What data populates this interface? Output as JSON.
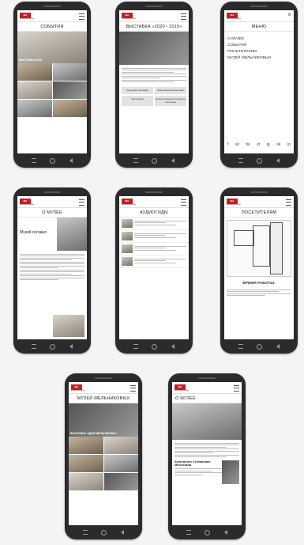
{
  "logo": {
    "text": "МА"
  },
  "phones": {
    "events": {
      "title": "СОБЫТИЯ",
      "hero_caption": "ВЫСТАВКА 2020"
    },
    "exhibition": {
      "title": "ВЫСТАВКА «2020 - 2015»",
      "buttons": [
        "Культурное наследие",
        "Какие вещества выставки",
        "Экспозиция",
        "Дополнительные материалы к выставке"
      ]
    },
    "menu": {
      "title": "МЕНЮ",
      "items": [
        "О МУЗЕЕ",
        "СОБЫТИЯ",
        "ПОСЕТИТЕЛЯМ",
        "МУЗЕЙ МЕЛЬНИКОВЫХ"
      ],
      "social_icons": [
        "f",
        "vk",
        "tw",
        "yt",
        "ig",
        "ok",
        "in"
      ]
    },
    "about": {
      "title": "О МУЗЕЕ",
      "heading": "Музей сегодня"
    },
    "audioguides": {
      "title": "АУДИОГИДЫ",
      "rows": 4
    },
    "visitors": {
      "title": "ПОСЕТИТЕЛЯМ",
      "hours_title": "ВРЕМЯ РАБОТЫ:"
    },
    "melnikov": {
      "title": "МУЗЕЙ МЕЛЬНИКОВЫХ",
      "caption": "ВЫСТАВКА «ДОМ МЕЛЬНИКОВА»"
    },
    "about2": {
      "title": "О МУЗЕЕ",
      "person": "Константин Степанович Мельников"
    }
  }
}
